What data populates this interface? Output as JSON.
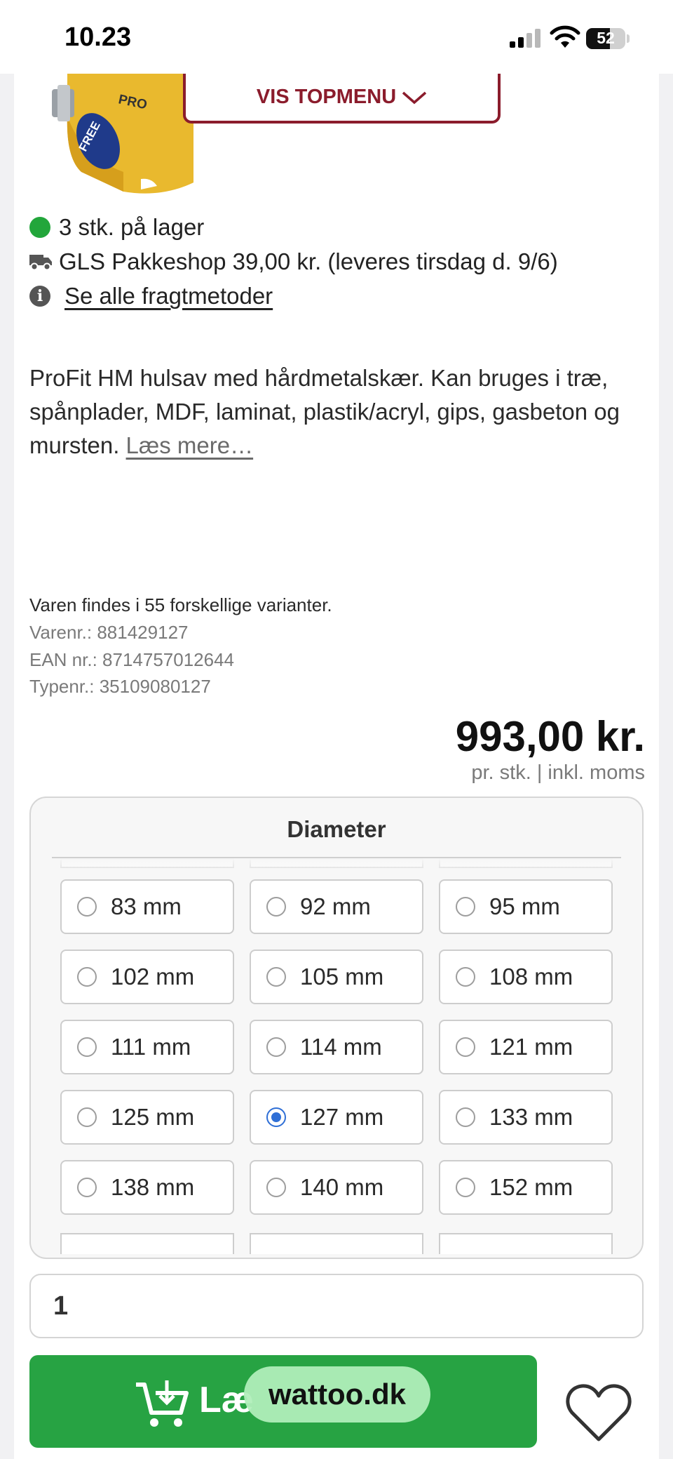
{
  "status_bar": {
    "time": "10.23",
    "battery": "52"
  },
  "header": {
    "vis_topmenu_label": "VIS TOPMENU"
  },
  "product": {
    "stock": "3 stk. på lager",
    "shipping": "GLS Pakkeshop 39,00 kr. (leveres tirsdag d. 9/6)",
    "shipping_methods_link": "Se alle fragtmetoder",
    "description": "ProFit HM hulsav med hårdmetalskær. Kan bruges i træ, spånplader, MDF, laminat, plastik/acryl, gips, gasbeton og mursten.",
    "read_more": "Læs mere…",
    "variants": "Varen findes i 55 forskellige varianter.",
    "item_number": "Varenr.: 881429127",
    "ean": "EAN nr.: 8714757012644",
    "type_number": "Typenr.: 35109080127",
    "price": "993,00 kr.",
    "price_note": "pr. stk. | inkl. moms",
    "image_brand_text": "PRO",
    "image_free_text": "FREE"
  },
  "diameter": {
    "title": "Diameter",
    "selected": "127 mm",
    "options": [
      "83 mm",
      "92 mm",
      "95 mm",
      "102 mm",
      "105 mm",
      "108 mm",
      "111 mm",
      "114 mm",
      "121 mm",
      "125 mm",
      "127 mm",
      "133 mm",
      "138 mm",
      "140 mm",
      "152 mm"
    ]
  },
  "quantity": {
    "value": "1"
  },
  "cart": {
    "add_label_visible": "Læ"
  },
  "watermark": "wattoo.dk",
  "colors": {
    "accent_red": "#8b1c2c",
    "button_green": "#27a343",
    "stock_green": "#22a63b",
    "radio_blue": "#2f6fd6"
  },
  "icons": [
    "green-status-dot",
    "truck-icon",
    "info-icon",
    "chevron-down-icon",
    "cart-add-icon",
    "heart-icon"
  ]
}
